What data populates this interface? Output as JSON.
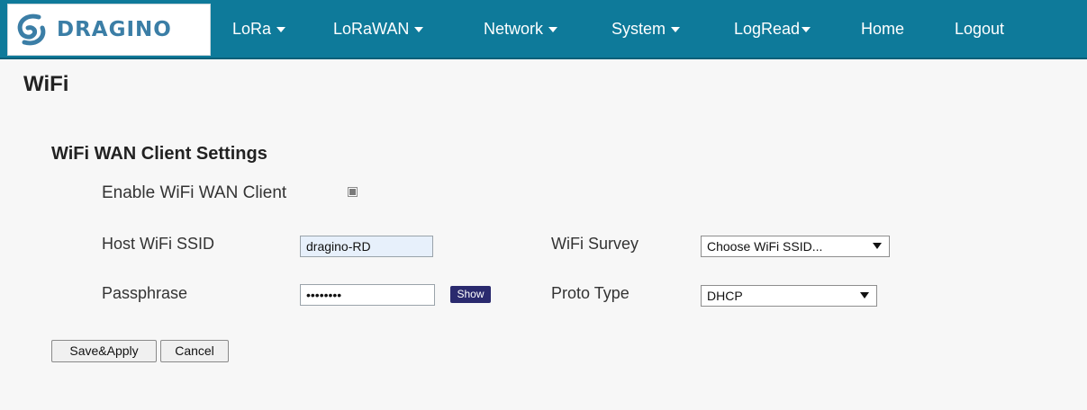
{
  "brand": {
    "name": "DRAGINO"
  },
  "nav": {
    "items": [
      {
        "label": "LoRa",
        "has_menu": true
      },
      {
        "label": "LoRaWAN",
        "has_menu": true
      },
      {
        "label": "Network",
        "has_menu": true
      },
      {
        "label": "System",
        "has_menu": true
      },
      {
        "label": "LogRead",
        "has_menu": true
      },
      {
        "label": "Home",
        "has_menu": false
      },
      {
        "label": "Logout",
        "has_menu": false
      }
    ]
  },
  "page": {
    "title": "WiFi"
  },
  "section": {
    "title": "WiFi WAN Client Settings"
  },
  "form": {
    "enable_label": "Enable WiFi WAN Client",
    "enable_checked": true,
    "ssid_label": "Host WiFi SSID",
    "ssid_value": "dragino-RD",
    "survey_label": "WiFi Survey",
    "survey_selected": "Choose WiFi SSID...",
    "pass_label": "Passphrase",
    "pass_value": "••••••••",
    "show_label": "Show",
    "proto_label": "Proto Type",
    "proto_selected": "DHCP"
  },
  "actions": {
    "save_label": "Save&Apply",
    "cancel_label": "Cancel"
  },
  "colors": {
    "navbar": "#0e7a9a",
    "logo_text": "#3b7ea6",
    "show_button": "#2a2a6e",
    "background": "#f7f7f7"
  }
}
